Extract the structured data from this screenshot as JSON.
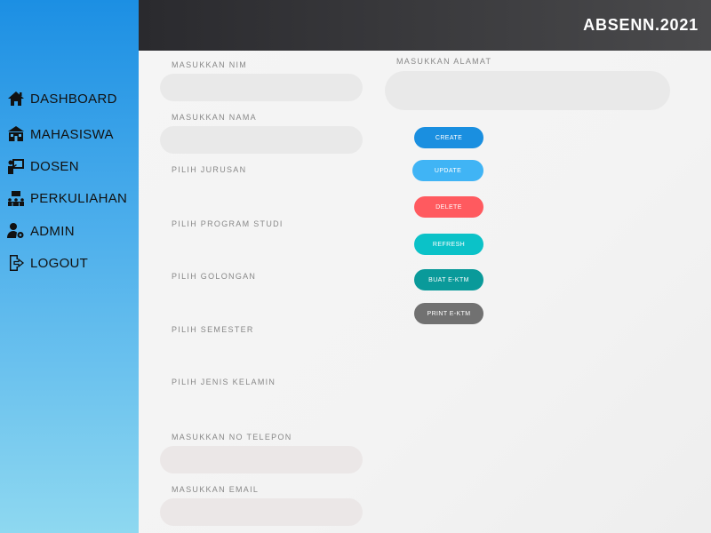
{
  "app": {
    "brand": "ABSENN.2021"
  },
  "sidebar": {
    "items": [
      {
        "label": "DASHBOARD",
        "icon": "home-icon"
      },
      {
        "label": "MAHASISWA",
        "icon": "school-icon"
      },
      {
        "label": "DOSEN",
        "icon": "teacher-icon"
      },
      {
        "label": "PERKULIAHAN",
        "icon": "classroom-icon"
      },
      {
        "label": "ADMIN",
        "icon": "user-gear-icon"
      },
      {
        "label": "LOGOUT",
        "icon": "logout-icon"
      }
    ]
  },
  "form": {
    "nim_label": "MASUKKAN NIM",
    "nim_value": "",
    "nama_label": "MASUKKAN NAMA",
    "nama_value": "",
    "jurusan_label": "PILIH JURUSAN",
    "prodi_label": "PILIH PROGRAM STUDI",
    "golongan_label": "PILIH GOLONGAN",
    "semester_label": "PILIH SEMESTER",
    "kelamin_label": "PILIH JENIS KELAMIN",
    "telepon_label": "MASUKKAN NO TELEPON",
    "telepon_value": "",
    "email_label": "MASUKKAN EMAIL",
    "email_value": "",
    "alamat_label": "MASUKKAN ALAMAT",
    "alamat_value": ""
  },
  "actions": {
    "create": "CREATE",
    "update": "UPDATE",
    "delete": "DELETE",
    "refresh": "REFRESH",
    "buat_ektm": "BUAT E-KTM",
    "print_ektm": "PRINT E-KTM"
  },
  "colors": {
    "create": "#1a8fe0",
    "update": "#40b4f5",
    "delete": "#ff5a5f",
    "refresh": "#0bc2c8",
    "buat_ektm": "#0a9a9a",
    "print_ektm": "#717171"
  }
}
